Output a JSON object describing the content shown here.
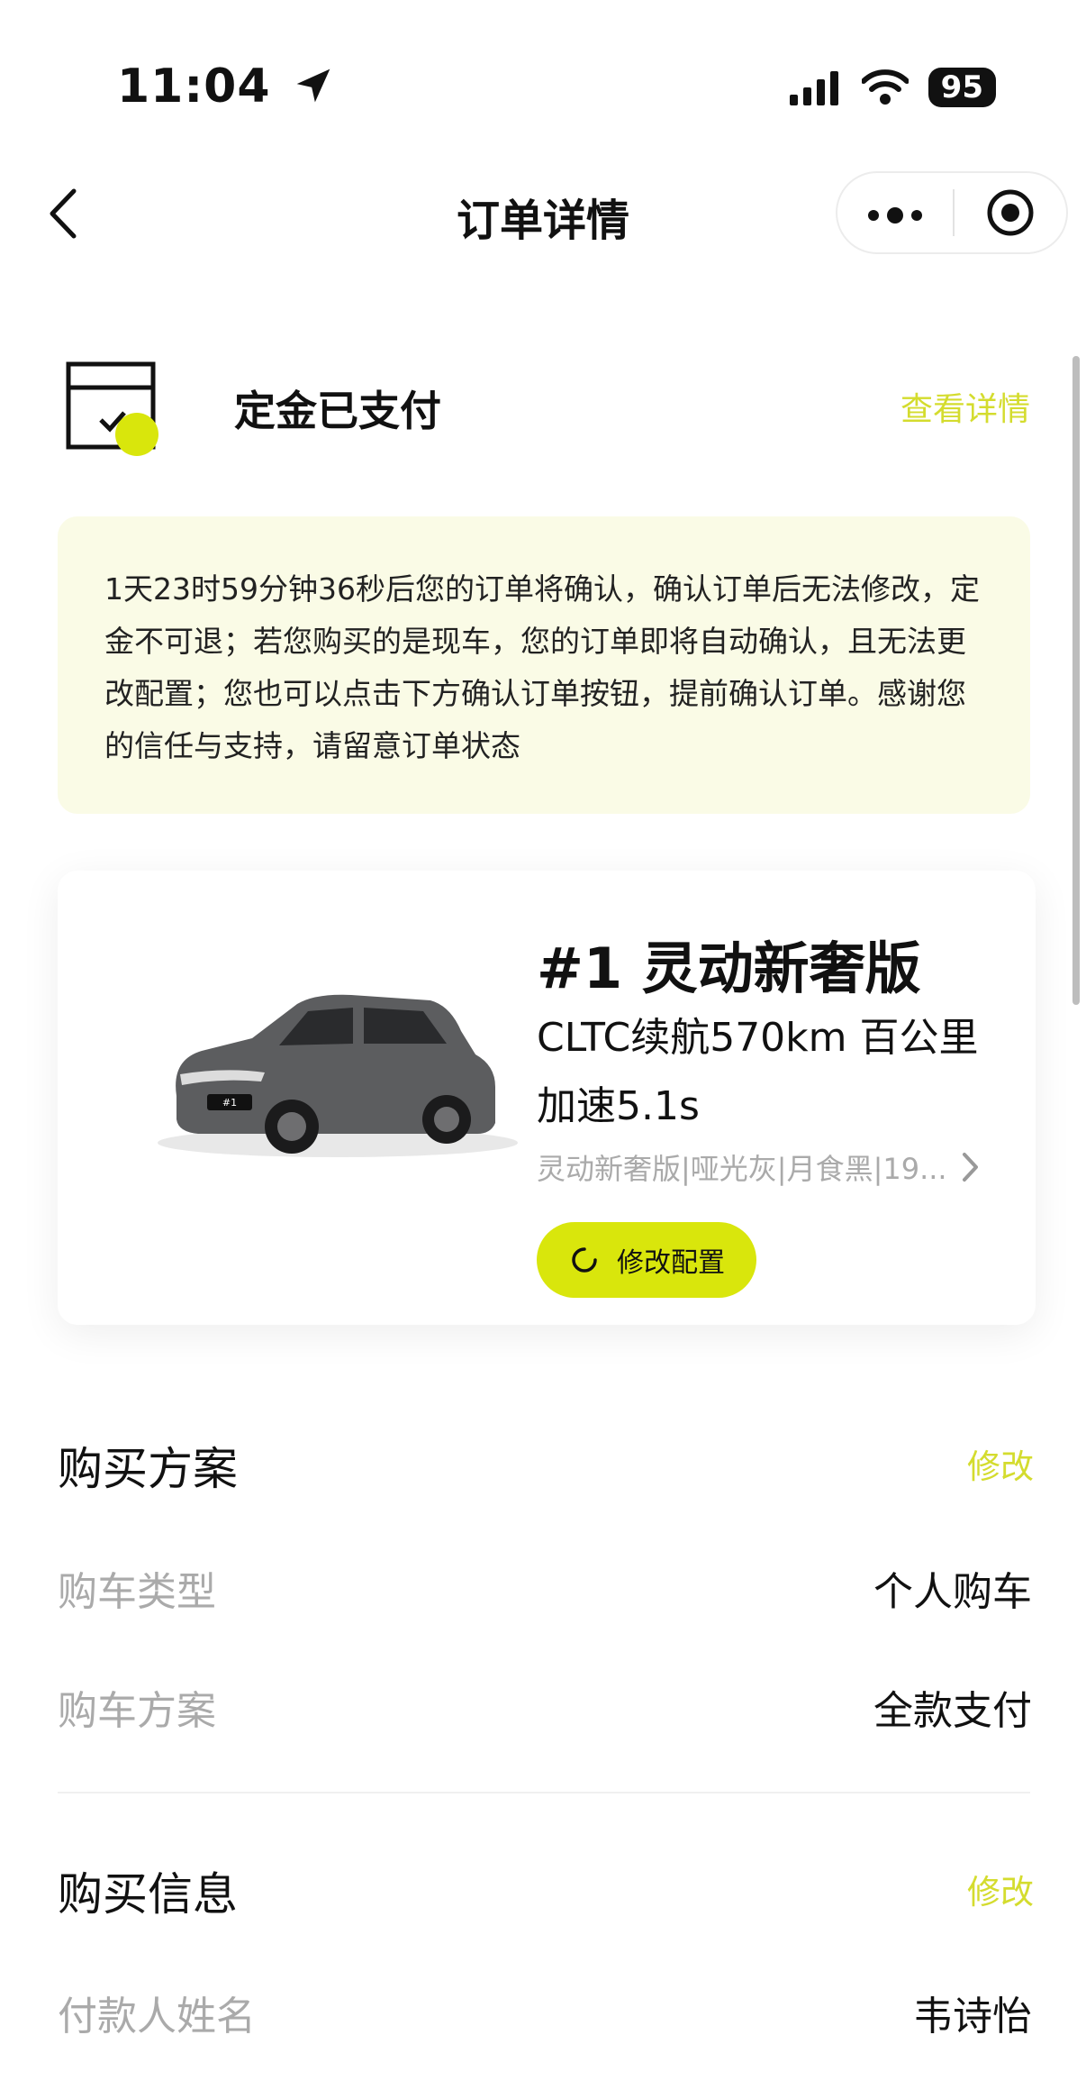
{
  "status_bar": {
    "time": "11:04",
    "battery": "95"
  },
  "nav": {
    "title": "订单详情"
  },
  "order_status": {
    "label": "定金已支付",
    "link": "查看详情"
  },
  "notice": {
    "text": "1天23时59分钟36秒后您的订单将确认，确认订单后无法修改，定金不可退；若您购买的是现车，您的订单即将自动确认，且无法更改配置；您也可以点击下方确认订单按钮，提前确认订单。感谢您的信任与支持，请留意订单状态"
  },
  "car": {
    "model": "#1 灵动新奢版",
    "description": "CLTC续航570km 百公里加速5.1s",
    "config": "灵动新奢版|哑光灰|月食黑|19...",
    "modify_button": "修改配置"
  },
  "purchase_plan": {
    "title": "购买方案",
    "action": "修改",
    "rows": [
      {
        "label": "购车类型",
        "value": "个人购车"
      },
      {
        "label": "购车方案",
        "value": "全款支付"
      }
    ]
  },
  "purchase_info": {
    "title": "购买信息",
    "action": "修改",
    "rows": [
      {
        "label": "付款人姓名",
        "value": "韦诗怡"
      }
    ]
  },
  "colors": {
    "accent": "#d9e60c",
    "accent_text": "#d4dc2e",
    "notice_bg": "#fafbe6"
  }
}
